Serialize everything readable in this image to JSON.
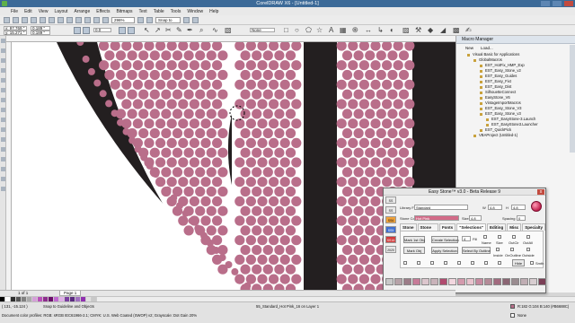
{
  "window": {
    "title": "CorelDRAW X6 - [Untitled-1]"
  },
  "menu": [
    "File",
    "Edit",
    "View",
    "Layout",
    "Arrange",
    "Effects",
    "Bitmaps",
    "Text",
    "Table",
    "Tools",
    "Window",
    "Help"
  ],
  "toolbar": {
    "zoom": "296%",
    "snap": "Snap to"
  },
  "propbar": {
    "x": "x: 97.769 \"",
    "y": "y: 15.271 \"",
    "w": "0.189 \"",
    "h": "0.189 \"",
    "angle": "0.0",
    "outline": "None"
  },
  "docker": {
    "title": "Macro Manager",
    "tools": [
      "New",
      "Load..."
    ],
    "tree": [
      {
        "level": 1,
        "label": "Visual Basic for Applications"
      },
      {
        "level": 2,
        "label": "GlobalMacros"
      },
      {
        "level": 3,
        "label": "EST_HotFix_HMP_Exp"
      },
      {
        "level": 3,
        "label": "EST_Easy_Stone_v2"
      },
      {
        "level": 3,
        "label": "EST_Easy_Guides"
      },
      {
        "level": 3,
        "label": "EST_Easy_Fixt"
      },
      {
        "level": 3,
        "label": "EST_Easy_Dist"
      },
      {
        "level": 3,
        "label": "SilhouetteConnect"
      },
      {
        "level": 3,
        "label": "EasyStone_V6"
      },
      {
        "level": 3,
        "label": "VintageImportMacros"
      },
      {
        "level": 3,
        "label": "EST_Easy_Stone_V3"
      },
      {
        "level": 3,
        "label": "EST_Easy_Stone_v3"
      },
      {
        "level": 4,
        "label": "EST_EasyStone-3.Launch"
      },
      {
        "level": 4,
        "label": "EST_EasyStone3.Launcher"
      },
      {
        "level": 3,
        "label": "EST_QuickPick"
      },
      {
        "level": 2,
        "label": "VBAProject (Untitled-1)"
      }
    ]
  },
  "dialog": {
    "title": "Easy Stone™ v3.0 - Beta Release 9",
    "close": "x",
    "left_buttons": [
      "SS",
      "SS",
      "SS6",
      "SS5",
      "SS16",
      "2020"
    ],
    "library_label": "Library File",
    "library_value": "Standard",
    "stone_color_label": "Stone Color",
    "stone_color_value": "Hot Pink",
    "size_label": "Size",
    "size_value": "4.8",
    "w_label": "W",
    "w_value": "4.8",
    "h_label": "H",
    "h_value": "4.8",
    "spacing_label": "Spacing",
    "spacing_value": "0",
    "tabs": [
      "Stone",
      "Stone Fill",
      "Fonts",
      "\"Selections\"",
      "Editing",
      "Misc",
      "Specialty"
    ],
    "panel": {
      "mark_1st": "Mark 1st Obj",
      "create_selection": "Create Selection",
      "mark_obj": "Mark Obj",
      "apply_selection": "Apply Selection",
      "select_by_outline": "Select By Outline",
      "num_value": "4",
      "num_label": "Fill",
      "checks": [
        "Name",
        "Size",
        "OutCir",
        "OutAll",
        "Inside",
        "OnOutline",
        "Outside"
      ],
      "radio_hide": "Hide",
      "radio_smth": "Smth"
    },
    "swatch_colors": [
      "#c8c8c8",
      "#b6a2a8",
      "#9c7c88",
      "#c77b98",
      "#dcc6cd",
      "#c9b3ba",
      "#b04b6f",
      "#f2d7df",
      "#d39aad",
      "#e9c3ce",
      "#c78aa0",
      "#b48b98",
      "#a26a7f",
      "#8b6573",
      "#9a8c90",
      "#c0aeb4",
      "#d7cdd0",
      "#7a3e55"
    ]
  },
  "canvas": {
    "stone_color": "#b96e8a",
    "shape_color": "#231f20"
  },
  "pagebar": {
    "pager": "1 of 1",
    "page_tab": "Page 1"
  },
  "palette_colors": [
    "#000000",
    "#ffffff",
    "#2d2d2d",
    "#555555",
    "#808080",
    "#aaaaaa",
    "#d4a0d8",
    "#b94fb9",
    "#8e2e8e",
    "#6a0f6a",
    "#c06ad0",
    "#e0b0e8",
    "#7b3fa0",
    "#5a2a80",
    "#a070c0",
    "#9030b0",
    "#e0e0e0",
    "#c8c8c8"
  ],
  "status": {
    "coords": "( 131, -15.124 )",
    "snap": "Snap to Guideline and Objects",
    "object": "55_Standard_Hot Pink_16 on Layer 1",
    "profile": "Document color profiles: RGB: sRGB IEC61966-2.1; CMYK: U.S. Web Coated (SWOP) v2; Grayscale: Dot Gain 20%",
    "fill": "R:182 G:104 B:140 (#B6688C)",
    "outline": "None"
  }
}
